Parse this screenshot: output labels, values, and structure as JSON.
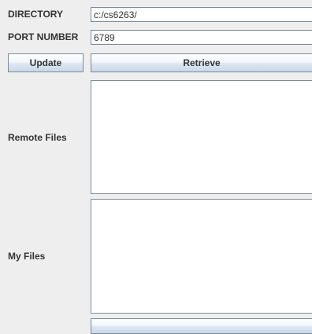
{
  "form": {
    "directory": {
      "label": "DIRECTORY",
      "value": "c:/cs6263/"
    },
    "port": {
      "label": "PORT NUMBER",
      "value": "6789"
    },
    "update_label": "Update",
    "retrieve_label": "Retrieve"
  },
  "remote_files": {
    "label": "Remote Files",
    "content": ""
  },
  "my_files": {
    "label": "My Files",
    "content": ""
  }
}
